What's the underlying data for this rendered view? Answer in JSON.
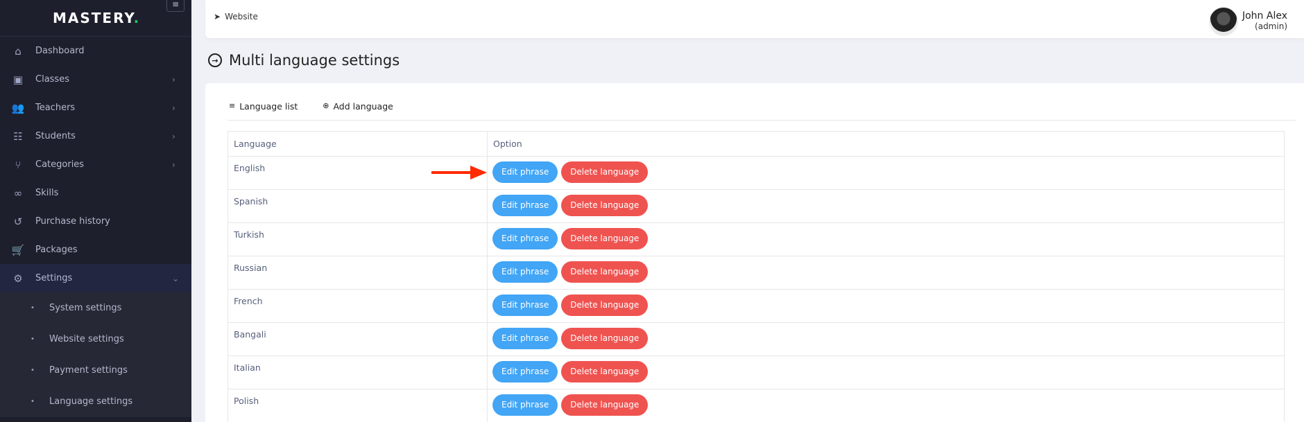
{
  "brand": {
    "name": "MASTERY",
    "dot": ".",
    "dot_color": "#22c55e"
  },
  "sidebar": {
    "toggle_icon": "hamburger-icon",
    "items": [
      {
        "label": "Dashboard",
        "icon": "home-icon",
        "glyph": "⌂",
        "has_children": false
      },
      {
        "label": "Classes",
        "icon": "chalkboard-teacher-icon",
        "glyph": "▣",
        "has_children": true
      },
      {
        "label": "Teachers",
        "icon": "users-icon",
        "glyph": "👥",
        "has_children": true
      },
      {
        "label": "Students",
        "icon": "user-group-icon",
        "glyph": "☷",
        "has_children": true
      },
      {
        "label": "Categories",
        "icon": "code-branch-icon",
        "glyph": "⑂",
        "has_children": true
      },
      {
        "label": "Skills",
        "icon": "infinity-icon",
        "glyph": "∞",
        "has_children": false
      },
      {
        "label": "Purchase history",
        "icon": "history-icon",
        "glyph": "↺",
        "has_children": false
      },
      {
        "label": "Packages",
        "icon": "cart-icon",
        "glyph": "🛒",
        "has_children": false
      },
      {
        "label": "Settings",
        "icon": "gears-icon",
        "glyph": "⚙",
        "has_children": true,
        "expanded": true
      }
    ],
    "settings_submenu": [
      {
        "label": "System settings"
      },
      {
        "label": "Website settings"
      },
      {
        "label": "Payment settings"
      },
      {
        "label": "Language settings"
      }
    ],
    "chevron_right": "›",
    "chevron_down": "⌄"
  },
  "topbar": {
    "website_label": "Website",
    "user_name": "John Alex",
    "user_role": "(admin)"
  },
  "page": {
    "title": "Multi language settings"
  },
  "tabs": [
    {
      "label": "Language list",
      "icon": "list-icon",
      "glyph": "≡"
    },
    {
      "label": "Add language",
      "icon": "plus-circle-icon",
      "glyph": "⊕"
    }
  ],
  "table": {
    "headers": [
      "Language",
      "Option"
    ],
    "rows": [
      {
        "language": "English"
      },
      {
        "language": "Spanish"
      },
      {
        "language": "Turkish"
      },
      {
        "language": "Russian"
      },
      {
        "language": "French"
      },
      {
        "language": "Bangali"
      },
      {
        "language": "Italian"
      },
      {
        "language": "Polish"
      }
    ],
    "edit_label": "Edit phrase",
    "delete_label": "Delete language"
  },
  "colors": {
    "sidebar_bg": "#1e1f2c",
    "edit_button": "#42a5f5",
    "delete_button": "#ef5350",
    "annotation_arrow": "#ff2a00"
  }
}
